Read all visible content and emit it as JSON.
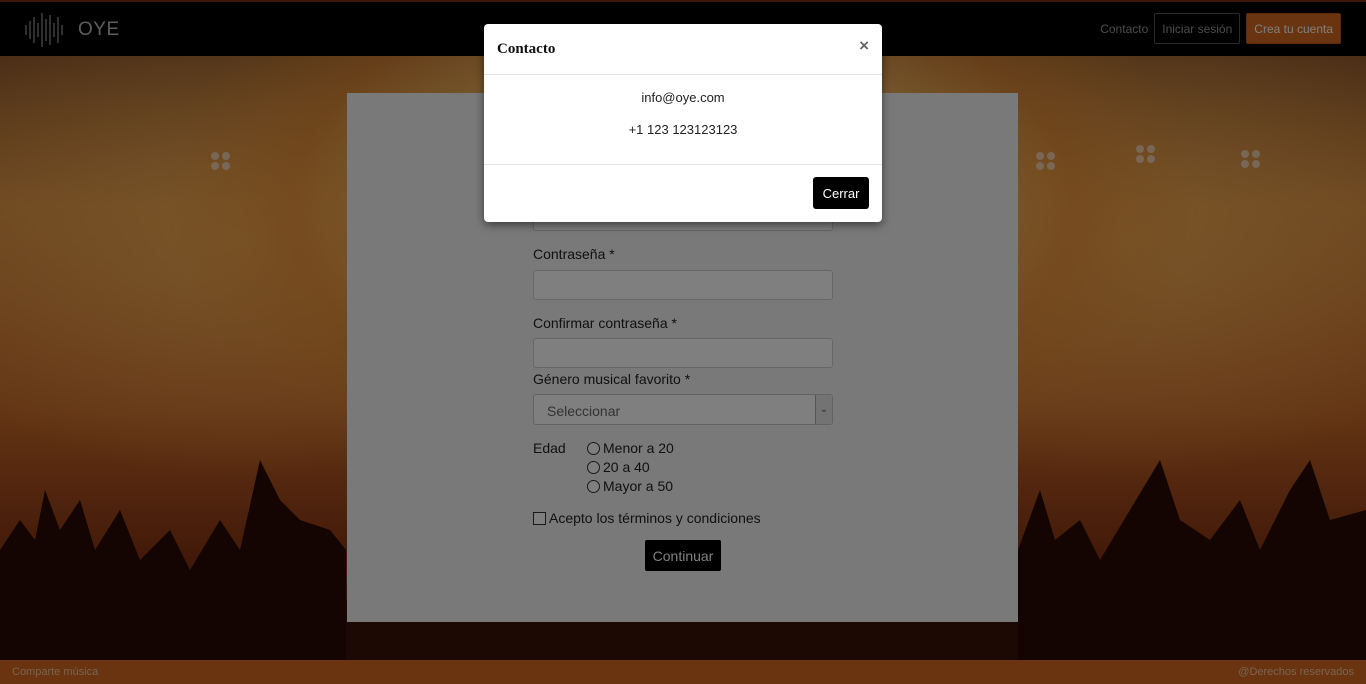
{
  "navbar": {
    "brand": "OYE",
    "links": {
      "contact": "Contacto",
      "login": "Iniciar sesión",
      "signup": "Crea tu cuenta"
    }
  },
  "form": {
    "password_label": "Contraseña *",
    "confirm_password_label": "Confirmar contraseña *",
    "genre_label": "Género musical favorito *",
    "genre_select_value": "Seleccionar",
    "age_label": "Edad",
    "age_options": [
      "Menor a 20",
      "20 a 40",
      "Mayor a 50"
    ],
    "terms_label": "Acepto los términos y condiciones",
    "submit_label": "Continuar"
  },
  "footer": {
    "left": "Comparte música",
    "right": "@Derechos reservados"
  },
  "modal": {
    "title": "Contacto",
    "close_glyph": "×",
    "email": "info@oye.com",
    "phone": "+1 123 123123123",
    "close_button": "Cerrar"
  },
  "colors": {
    "accent": "#d2691e",
    "navbar": "#000000",
    "card": "#f2f2f2",
    "button": "#000000"
  },
  "icons": {
    "logo": "soundwave-logo-icon",
    "close": "close-icon",
    "select_arrow": "chevron-down-icon"
  }
}
